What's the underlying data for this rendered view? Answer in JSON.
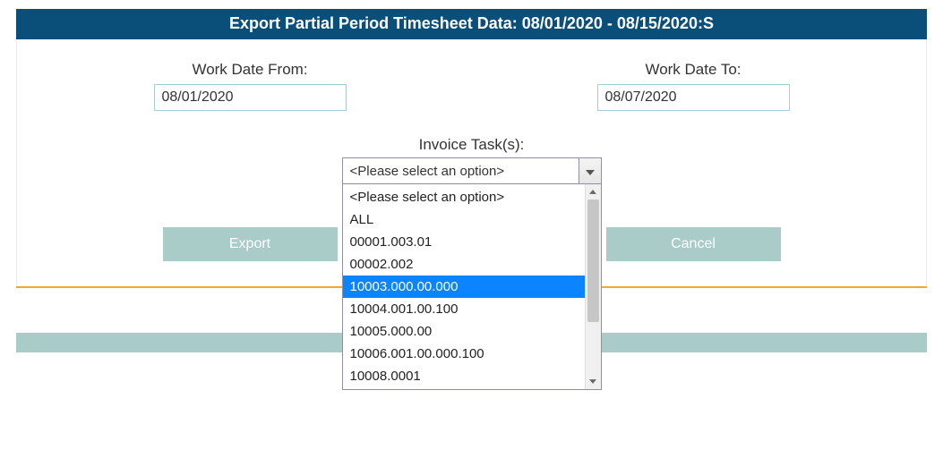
{
  "header": {
    "title": "Export Partial Period Timesheet Data: 08/01/2020 - 08/15/2020:S"
  },
  "dates": {
    "from_label": "Work Date From:",
    "from_value": "08/01/2020",
    "to_label": "Work Date To:",
    "to_value": "08/07/2020"
  },
  "task": {
    "label": "Invoice Task(s):",
    "selected": "<Please select an option>",
    "options": [
      {
        "label": "<Please select an option>",
        "highlight": false
      },
      {
        "label": "ALL",
        "highlight": false
      },
      {
        "label": "00001.003.01",
        "highlight": false
      },
      {
        "label": "00002.002",
        "highlight": false
      },
      {
        "label": "10003.000.00.000",
        "highlight": true
      },
      {
        "label": "10004.001.00.100",
        "highlight": false
      },
      {
        "label": "10005.000.00",
        "highlight": false
      },
      {
        "label": "10006.001.00.000.100",
        "highlight": false
      },
      {
        "label": "10008.0001",
        "highlight": false
      }
    ]
  },
  "buttons": {
    "export": "Export",
    "cancel": "Cancel"
  }
}
